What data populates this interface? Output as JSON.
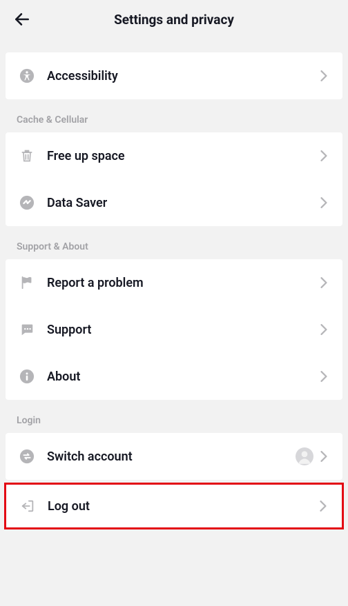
{
  "header": {
    "title": "Settings and privacy"
  },
  "sections": {
    "top": {
      "accessibility": "Accessibility"
    },
    "cache": {
      "header": "Cache & Cellular",
      "free_up_space": "Free up space",
      "data_saver": "Data Saver"
    },
    "support": {
      "header": "Support & About",
      "report": "Report a problem",
      "support_label": "Support",
      "about": "About"
    },
    "login": {
      "header": "Login",
      "switch_account": "Switch account",
      "log_out": "Log out"
    }
  }
}
